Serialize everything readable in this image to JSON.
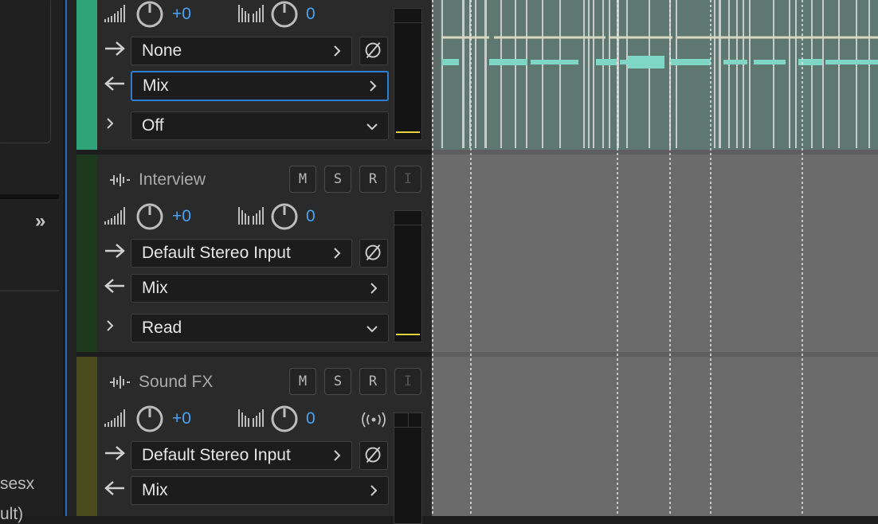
{
  "left_panel": {
    "expand_label": "»",
    "file_label": "sesx",
    "file_sub": "ult)"
  },
  "tracks": [
    {
      "name": "",
      "color": "#2fa37a",
      "volume": "+0",
      "pan": "0",
      "input": "None",
      "output": "Mix",
      "automation": "Off",
      "output_active": true
    },
    {
      "name": "Interview",
      "color": "#1e3a1e",
      "volume": "+0",
      "pan": "0",
      "input": "Default Stereo Input",
      "output": "Mix",
      "automation": "Read",
      "buttons": {
        "mute": "M",
        "solo": "S",
        "record": "R",
        "input": "I"
      }
    },
    {
      "name": "Sound FX",
      "color": "#4a4a1e",
      "volume": "+0",
      "pan": "0",
      "input": "Default Stereo Input",
      "output": "Mix",
      "buttons": {
        "mute": "M",
        "solo": "S",
        "record": "R",
        "input": "I"
      }
    }
  ],
  "colors": {
    "accent": "#4aa3f0",
    "selection_border": "#2a7fd4",
    "clip_waveform": "#7fd6c4",
    "meter_peak": "#e2d23b"
  }
}
